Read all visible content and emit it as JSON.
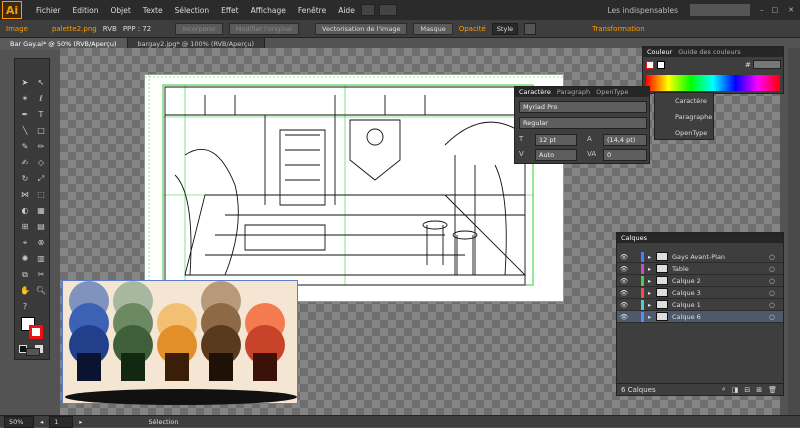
{
  "app": {
    "logo": "Ai",
    "workspace": "Les indispensables"
  },
  "menu": [
    "Fichier",
    "Edition",
    "Objet",
    "Texte",
    "Sélection",
    "Effet",
    "Affichage",
    "Fenêtre",
    "Aide"
  ],
  "control_bar": {
    "image_label": "Image",
    "file_link": "palette2.png",
    "color_mode": "RVB",
    "ppp": "PPP : 72",
    "embed": "Incorporer",
    "edit_original": "Modifier l'original",
    "vectorize": "Vectorisation de l'image",
    "mask": "Masque",
    "opacity": "Opacité",
    "style": "Style",
    "transform": "Transformation"
  },
  "doc_tabs": [
    "Bar Gay.ai* @ 50% (RVB/Aperçu)",
    "bargay2.jpg* @ 100% (RVB/Aperçu)"
  ],
  "color_panel": {
    "tab1": "Couleur",
    "tab2": "Guide des couleurs",
    "hex_label": "#"
  },
  "character_panel": {
    "tabs": [
      "Caractère",
      "Paragraph",
      "OpenType"
    ],
    "font": "Myriad Pro",
    "style": "Regular",
    "size": "12 pt",
    "leading": "(14,4 pt)",
    "kerning": "Auto",
    "tracking": "0"
  },
  "mini_panel": [
    "Caractère",
    "Paragraphe",
    "OpenType"
  ],
  "layers_panel": {
    "title": "Calques",
    "layers": [
      {
        "name": "Gays Avant-Plan",
        "color": "#4a7cff"
      },
      {
        "name": "Table",
        "color": "#d048d0"
      },
      {
        "name": "Calque 2",
        "color": "#4ad04a"
      },
      {
        "name": "Calque 3",
        "color": "#ff4a4a"
      },
      {
        "name": "Calque 1",
        "color": "#4ad0d0"
      },
      {
        "name": "Calque 6",
        "color": "#5a8aff"
      }
    ],
    "count": "6 Calques"
  },
  "status": {
    "zoom": "50%",
    "artboard": "1",
    "tool": "Sélection"
  },
  "palette_colors": {
    "row1": [
      "#7f93be",
      "#a8b8a0",
      "#f5e6d3",
      "#b89a7a",
      "#f5e6d3"
    ],
    "row2": [
      "#3b62b5",
      "#6c8a62",
      "#f3c073",
      "#8d6a45",
      "#f47a50"
    ],
    "row3": [
      "#213f8a",
      "#3e5f3a",
      "#e28f2a",
      "#5a3a1e",
      "#c8432a"
    ],
    "square": [
      "#0a1430",
      "#122812",
      "#3a1e08",
      "#1e1208",
      "#3a1208"
    ]
  }
}
